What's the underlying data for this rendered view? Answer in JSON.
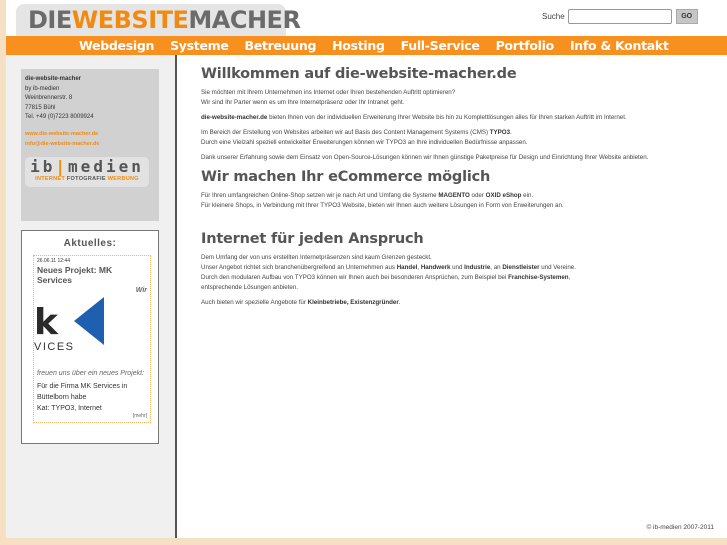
{
  "header": {
    "logo": {
      "part1": "DIE",
      "part2": "WEBSITE",
      "part3": "MACHER"
    },
    "search": {
      "label": "Suche",
      "value": "",
      "placeholder": "",
      "button": "GO"
    }
  },
  "nav": {
    "items": [
      {
        "label": "Webdesign"
      },
      {
        "label": "Systeme"
      },
      {
        "label": "Betreuung"
      },
      {
        "label": "Hosting"
      },
      {
        "label": "Full-Service"
      },
      {
        "label": "Portfolio"
      },
      {
        "label": "Info & Kontakt"
      }
    ]
  },
  "sidebar": {
    "contact": {
      "name": "die-website-macher",
      "by": "by ib-medien",
      "street": "Weinbrennerstr. 8",
      "city": "77815 Bühl",
      "phone": "Tel. +49 (0)7223 8009924",
      "web": "www.die-website-macher.de",
      "email": "info@die-website-macher.de"
    },
    "ib_logo": {
      "left": "ib",
      "bar": "|",
      "right": "medien",
      "sub1": "INTERNET",
      "sub2": "FOTOGRAFIE",
      "sub3": "WERBUNG"
    },
    "news": {
      "title": "Aktuelles:",
      "date": "26.06.11 12:44",
      "heading": "Neues Projekt: MK Services",
      "wir": "Wir",
      "logo_text": "k",
      "logo_sub": "VICES",
      "teaser": "freuen uns über ein neues Projekt:",
      "body_line1": "Für die Firma MK Services in",
      "body_line2": "Büttelborn habe",
      "category": "Kat: TYPO3, Internet",
      "more": "[mehr]"
    }
  },
  "content": {
    "sections": [
      {
        "title": "Willkommen auf die-website-macher.de",
        "p1_line1": "Sie möchten mit Ihrem Unternehmen ins Internet oder Ihren bestehenden Auftritt optimieren?",
        "p1_line2": "Wir sind Ihr Parter wenn es um Ihre Internetpräsenz oder Ihr Intranet geht.",
        "p2_bold": "die-website-macher.de",
        "p2_text": " bieten Ihnen von der individuellen Erweiterung Ihrer Website bis hin zu Komplettlösungen alles für Ihren starken Auftritt im Internet.",
        "p3_line1": "Im Bereich der Erstellung von Websites arbeiten wir auf Basis des Content Management Systems (CMS) ",
        "p3_bold": "TYPO3",
        "p3_line1_end": ".",
        "p3_line2": "Durch eine Vielzahl speziell entwickelter Erweiterungen können wir TYPO3 an Ihre individuellen Bedürfnisse anpassen.",
        "p4": "Dank unserer Erfahrung sowie dem Einsatz von Open-Source-Lösungen können wir Ihnen günstige Paketpreise für Design und Einrichtung Ihrer Website anbieten."
      },
      {
        "title": "Wir machen Ihr eCommerce möglich",
        "p1_a": "Für Ihren umfangreichen Online-Shop setzen wir je nach Art und Umfang die Systeme ",
        "p1_b1": "MAGENTO",
        "p1_c": " oder ",
        "p1_b2": "OXID eShop",
        "p1_d": " ein.",
        "p1_line2": "Für kleinere Shops, in Verbindung mit Ihrer TYPO3 Website, bieten wir Ihnen auch weitere Lösungen in Form von Erweiterungen an."
      },
      {
        "title": "Internet für jeden Anspruch",
        "l1": "Dem Umfang der von uns erstellten Internetpräsenzen sind kaum Grenzen gesteckt.",
        "l2_a": "Unser Angebot richtet sich branchenübergreifend an Unternehmen aus ",
        "l2_b1": "Handel",
        "l2_c": ", ",
        "l2_b2": "Handwerk",
        "l2_d": " und ",
        "l2_b3": "Industrie",
        "l2_e": ", an ",
        "l2_b4": "Dienstleister",
        "l2_f": " und Vereine.",
        "l3_a": "Durch den modularen Aufbau von TYPO3 können wir Ihnen auch bei besonderen Ansprüchen, zum Beispiel bei ",
        "l3_b": "Franchise-Systemen",
        "l3_c": ",",
        "l4": "entsprechende Lösungen anbieten.",
        "p2_a": "Auch bieten wir spezielle Angebote für ",
        "p2_b": "Kleinbetriebe, Existenzgründer",
        "p2_c": "."
      }
    ]
  },
  "footer": {
    "copyright": "© ib-medien 2007-2011"
  }
}
